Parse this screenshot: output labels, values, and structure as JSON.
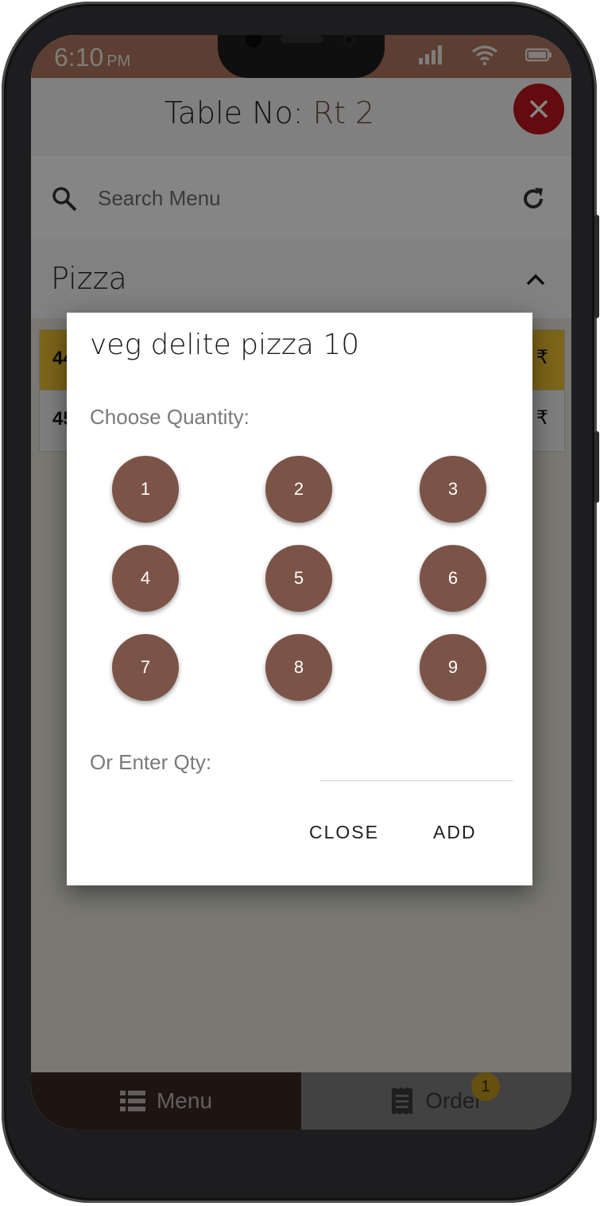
{
  "status_bar": {
    "time": "6:10",
    "ampm": "PM"
  },
  "header": {
    "title_prefix": "Table No: ",
    "table_value": "Rt 2"
  },
  "search": {
    "placeholder": "Search Menu"
  },
  "category": {
    "name": "Pizza"
  },
  "menu_rows": [
    {
      "num_partial": "44",
      "price_symbol": "₹",
      "color": "#f0c232"
    },
    {
      "num_partial": "45",
      "price_symbol": "₹",
      "color": "#f3f3f3"
    }
  ],
  "dialog": {
    "title": "veg delite pizza 10",
    "choose_label": "Choose Quantity:",
    "quantities": [
      "1",
      "2",
      "3",
      "4",
      "5",
      "6",
      "7",
      "8",
      "9"
    ],
    "enter_label": "Or Enter Qty:",
    "qty_value": "",
    "close_label": "CLOSE",
    "add_label": "ADD"
  },
  "bottom_nav": {
    "menu_label": "Menu",
    "order_label": "Order",
    "order_badge": "1"
  },
  "colors": {
    "accent": "#7b5447",
    "status_bar": "#b07860",
    "close_fab": "#c0161e",
    "badge": "#c39a1e"
  },
  "icons": {
    "search": "search-icon",
    "refresh": "refresh-icon",
    "chevron": "chevron-up-icon",
    "close": "close-icon",
    "menu": "list-icon",
    "order": "receipt-icon"
  }
}
